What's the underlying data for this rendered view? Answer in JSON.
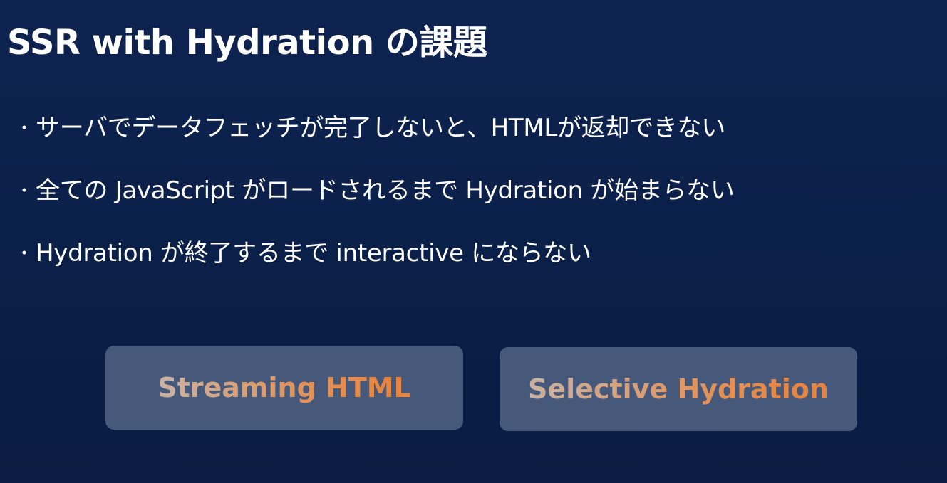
{
  "slide": {
    "title": "SSR with Hydration の課題",
    "bullet_marker": "・",
    "bullets": [
      "サーバでデータフェッチが完了しないと、HTMLが返却できない",
      "全ての JavaScript がロードされるまで Hydration が始まらない",
      "Hydration が終了するまで interactive にならない"
    ],
    "solutions": [
      "Streaming HTML",
      "Selective Hydration"
    ]
  },
  "colors": {
    "background": "#0b2049",
    "pill_background": "#46597b",
    "pill_text_start": "#c9b3a4",
    "pill_text_end": "#e8823d"
  }
}
